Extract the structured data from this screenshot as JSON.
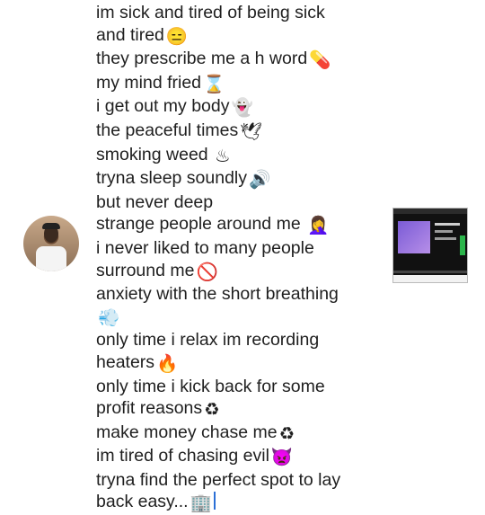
{
  "poem_lines": [
    {
      "text": "im sick and tired of being sick",
      "emoji": ""
    },
    {
      "text": "and tired",
      "emoji": "😑"
    },
    {
      "text": "they prescribe me a h word",
      "emoji": "💊"
    },
    {
      "text": "my mind fried",
      "emoji": "⌛"
    },
    {
      "text": "i get out my body",
      "emoji": "👻"
    },
    {
      "text": "the peaceful times",
      "emoji": "🕊"
    },
    {
      "text": "smoking weed ",
      "emoji": "♨"
    },
    {
      "text": "tryna sleep soundly",
      "emoji": "🔊"
    },
    {
      "text": "but never deep",
      "emoji": ""
    },
    {
      "text": "strange people around me ",
      "emoji": "🤦‍♀️"
    },
    {
      "text": "i never liked to many people",
      "emoji": ""
    },
    {
      "text": "surround me",
      "emoji": "🚫"
    },
    {
      "text": "anxiety with the short breathing",
      "emoji": ""
    },
    {
      "text": "",
      "emoji": "💨"
    },
    {
      "text": "only time i relax im recording",
      "emoji": ""
    },
    {
      "text": "heaters",
      "emoji": "🔥"
    },
    {
      "text": "only time i kick back for some",
      "emoji": ""
    },
    {
      "text": "profit reasons",
      "emoji": "♻"
    },
    {
      "text": "make money chase me",
      "emoji": "♻"
    },
    {
      "text": "im tired of chasing evil",
      "emoji": "👿"
    },
    {
      "text": "tryna find the perfect spot to lay",
      "emoji": ""
    },
    {
      "text": "back easy...",
      "emoji": "🏢"
    }
  ]
}
